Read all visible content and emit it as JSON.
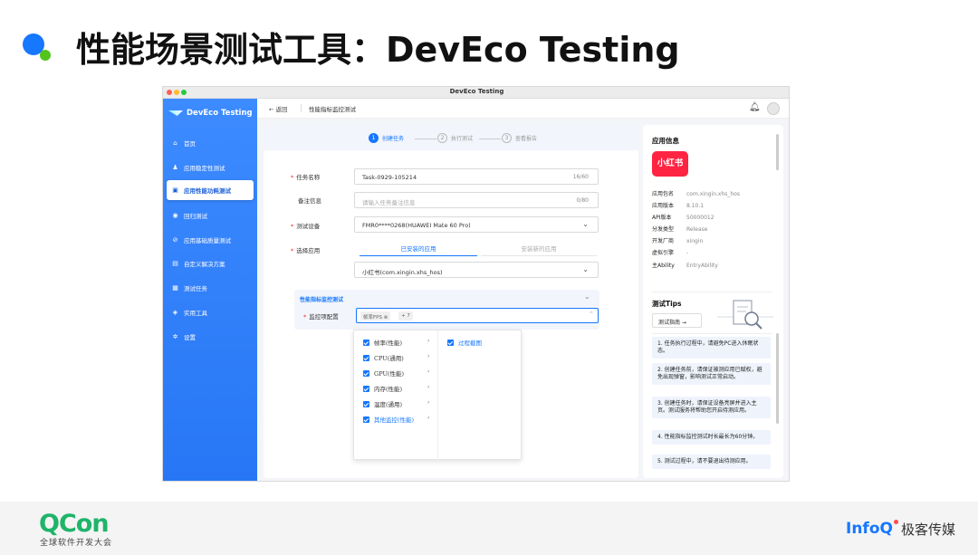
{
  "slide": {
    "title": "性能场景测试工具：DevEco Testing"
  },
  "window": {
    "title": "DevEco Testing",
    "traffic_light_colors": [
      "#ff5f57",
      "#febc2e",
      "#28c840"
    ]
  },
  "sidebar": {
    "logo_text": "DevEco Testing",
    "items": [
      {
        "label": "首页",
        "icon": "home-icon",
        "active": false
      },
      {
        "label": "应用稳定性测试",
        "icon": "stability-icon",
        "active": false
      },
      {
        "label": "应用性能功耗测试",
        "icon": "performance-icon",
        "active": true
      },
      {
        "label": "回归测试",
        "icon": "regression-icon",
        "active": false
      },
      {
        "label": "应用基础质量测试",
        "icon": "quality-icon",
        "active": false
      },
      {
        "label": "自定义解决方案",
        "icon": "custom-icon",
        "active": false
      },
      {
        "label": "测试任务",
        "icon": "task-icon",
        "active": false
      },
      {
        "label": "实用工具",
        "icon": "tool-icon",
        "active": false
      },
      {
        "label": "设置",
        "icon": "gear-icon",
        "active": false
      }
    ]
  },
  "topbar": {
    "back_label": "← 返回",
    "breadcrumb": "性能指标监控测试"
  },
  "steps": [
    {
      "num": "1",
      "label": "创建任务",
      "active": true
    },
    {
      "num": "2",
      "label": "执行测试",
      "active": false
    },
    {
      "num": "3",
      "label": "查看报告",
      "active": false
    }
  ],
  "form": {
    "task_name": {
      "label": "任务名称",
      "value": "Task-0929-105214",
      "count": "16/60"
    },
    "remark": {
      "label": "备注信息",
      "placeholder": "请输入任务备注信息",
      "count": "0/80"
    },
    "device": {
      "label": "测试设备",
      "value": "FMR0****0268(HUAWEI Mate 60 Pro)"
    },
    "app": {
      "label": "选择应用",
      "tab_installed": "已安装的应用",
      "tab_new": "安装新的应用",
      "value": "小红书(com.xingin.xhs_hos)"
    },
    "perf_section": {
      "title": "性能指标监控测试",
      "monitor_label": "监控项配置",
      "tags": [
        "帧率FPS",
        "+ 7"
      ]
    }
  },
  "dropdown": {
    "left_items": [
      "帧率(性能)",
      "CPU(通用)",
      "GPU(性能)",
      "内存(性能)",
      "温度(通用)",
      "其他监控(性能)"
    ],
    "right_items": [
      "过程截图"
    ],
    "accent": "#1677ff"
  },
  "app_info": {
    "title": "应用信息",
    "icon_text": "小红书",
    "icon_color": "#ff2442",
    "fields": [
      {
        "k": "应用包名",
        "v": "com.xingin.xhs_hos"
      },
      {
        "k": "应用版本",
        "v": "8.10.1"
      },
      {
        "k": "API版本",
        "v": "50000012"
      },
      {
        "k": "分发类型",
        "v": "Release"
      },
      {
        "k": "开发厂商",
        "v": "xingin"
      },
      {
        "k": "虚拟引擎",
        "v": "-"
      },
      {
        "k": "主Ability",
        "v": "EntryAbility"
      }
    ]
  },
  "tips": {
    "title": "测试Tips",
    "guide_label": "测试指南 →",
    "items": [
      "1. 任务执行过程中，请避免PC进入休眠状态。",
      "2. 创建任务前，请保证被测应用已赋权，避免出现弹窗，影响测试正常启动。",
      "3. 创建任务时，请保证设备亮屏并进入主页。测试服务将帮助您开启待测应用。",
      "4. 性能指标监控测试时长最长为60分钟。",
      "5. 测试过程中，请不要退出待测应用。"
    ]
  },
  "footer": {
    "qcon": "QCon",
    "qcon_sub": "全球软件开发大会",
    "infoq": "InfoQ",
    "infoq_cn": "极客传媒"
  }
}
